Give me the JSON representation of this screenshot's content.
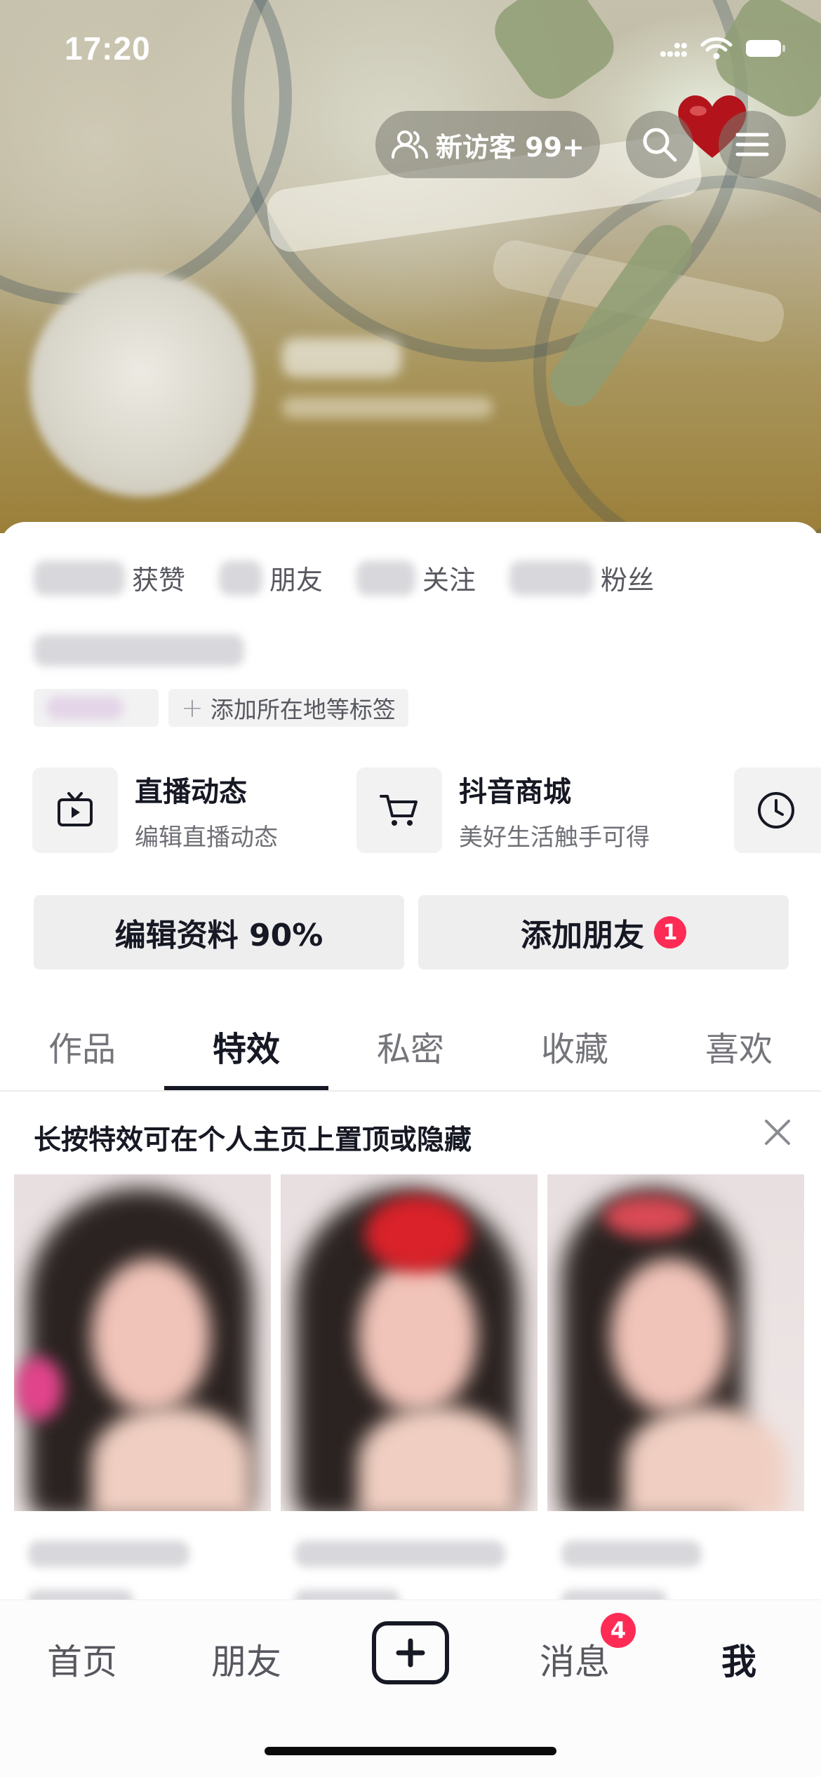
{
  "status_bar": {
    "time": "17:20"
  },
  "header": {
    "visitor_label": "新访客 99+",
    "search_icon": "search-icon",
    "menu_icon": "menu-icon"
  },
  "stats": [
    {
      "label": "获赞"
    },
    {
      "label": "朋友"
    },
    {
      "label": "关注"
    },
    {
      "label": "粉丝"
    }
  ],
  "tags": {
    "add_tag_label": "添加所在地等标签"
  },
  "services": [
    {
      "title": "直播动态",
      "subtitle": "编辑直播动态",
      "icon": "tv-icon"
    },
    {
      "title": "抖音商城",
      "subtitle": "美好生活触手可得",
      "icon": "cart-icon"
    }
  ],
  "actions": {
    "edit_profile": "编辑资料 90%",
    "add_friend": "添加朋友",
    "add_friend_badge": "1"
  },
  "profile_tabs": [
    "作品",
    "特效",
    "私密",
    "收藏",
    "喜欢"
  ],
  "active_profile_tab": "特效",
  "hint_text": "长按特效可在个人主页上置顶或隐藏",
  "bottom_nav": {
    "home": "首页",
    "friends": "朋友",
    "messages": "消息",
    "messages_badge": "4",
    "me": "我"
  },
  "colors": {
    "accent": "#fe2c55",
    "text": "#161823"
  }
}
